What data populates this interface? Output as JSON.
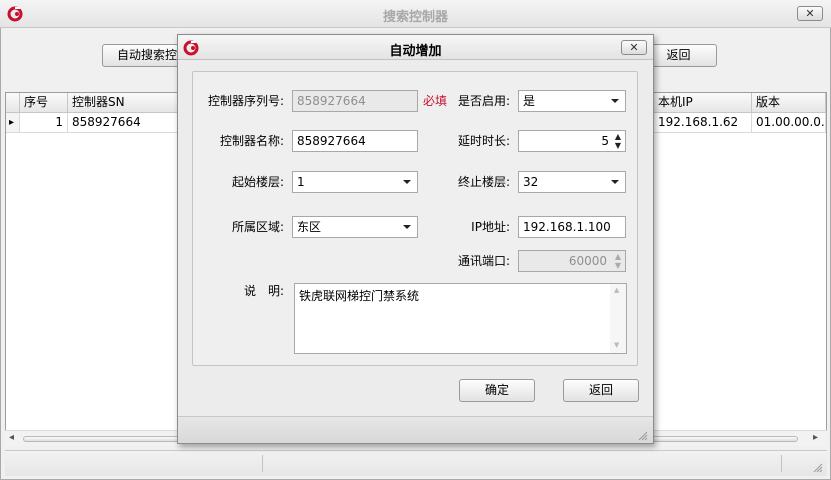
{
  "window": {
    "title": "搜索控制器",
    "close_glyph": "✕",
    "buttons": {
      "auto_search": "自动搜索控",
      "back": "返回"
    },
    "grid": {
      "columns": {
        "seq": "序号",
        "sn": "控制器SN",
        "ip": "本机IP",
        "version": "版本"
      },
      "rows": [
        {
          "marker": "▸",
          "seq": "1",
          "sn": "858927664",
          "ip": "192.168.1.62",
          "version": "01.00.00.0..."
        }
      ]
    },
    "scroll": {
      "left": "◂",
      "right": "▸"
    }
  },
  "dialog": {
    "title": "自动增加",
    "close_glyph": "✕",
    "fields": {
      "serial": {
        "label": "控制器序列号:",
        "value": "858927664",
        "required": "必填"
      },
      "enabled": {
        "label": "是否启用:",
        "value": "是"
      },
      "name": {
        "label": "控制器名称:",
        "value": "858927664"
      },
      "delay": {
        "label": "延时时长:",
        "value": "5"
      },
      "start_floor": {
        "label": "起始楼层:",
        "value": "1"
      },
      "end_floor": {
        "label": "终止楼层:",
        "value": "32"
      },
      "area": {
        "label": "所属区域:",
        "value": "东区"
      },
      "ip": {
        "label": "IP地址:",
        "value": "192.168.1.100"
      },
      "port": {
        "label": "通讯端口:",
        "value": "60000"
      },
      "desc": {
        "label": "说　明:",
        "value": "铁虎联网梯控门禁系统"
      }
    },
    "buttons": {
      "ok": "确定",
      "back": "返回"
    }
  },
  "colors": {
    "required": "#c8102e",
    "logo": "#c8102e"
  }
}
